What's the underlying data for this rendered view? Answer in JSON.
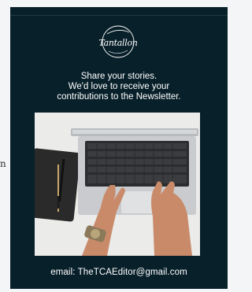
{
  "edge_text": "n",
  "newsletter": {
    "logo_text": "Tantallon",
    "message_lines": [
      "Share your stories.",
      "We'd love to receive your",
      "contributions to the Newsletter."
    ],
    "email_line": "email: TheTCAEditor@gmail.com"
  },
  "photo": {
    "icon": "laptop-notebook-hands-photo"
  },
  "colors": {
    "panel_background": "#08202a",
    "text": "#ffffff",
    "page_background": "#f3f5f7"
  }
}
